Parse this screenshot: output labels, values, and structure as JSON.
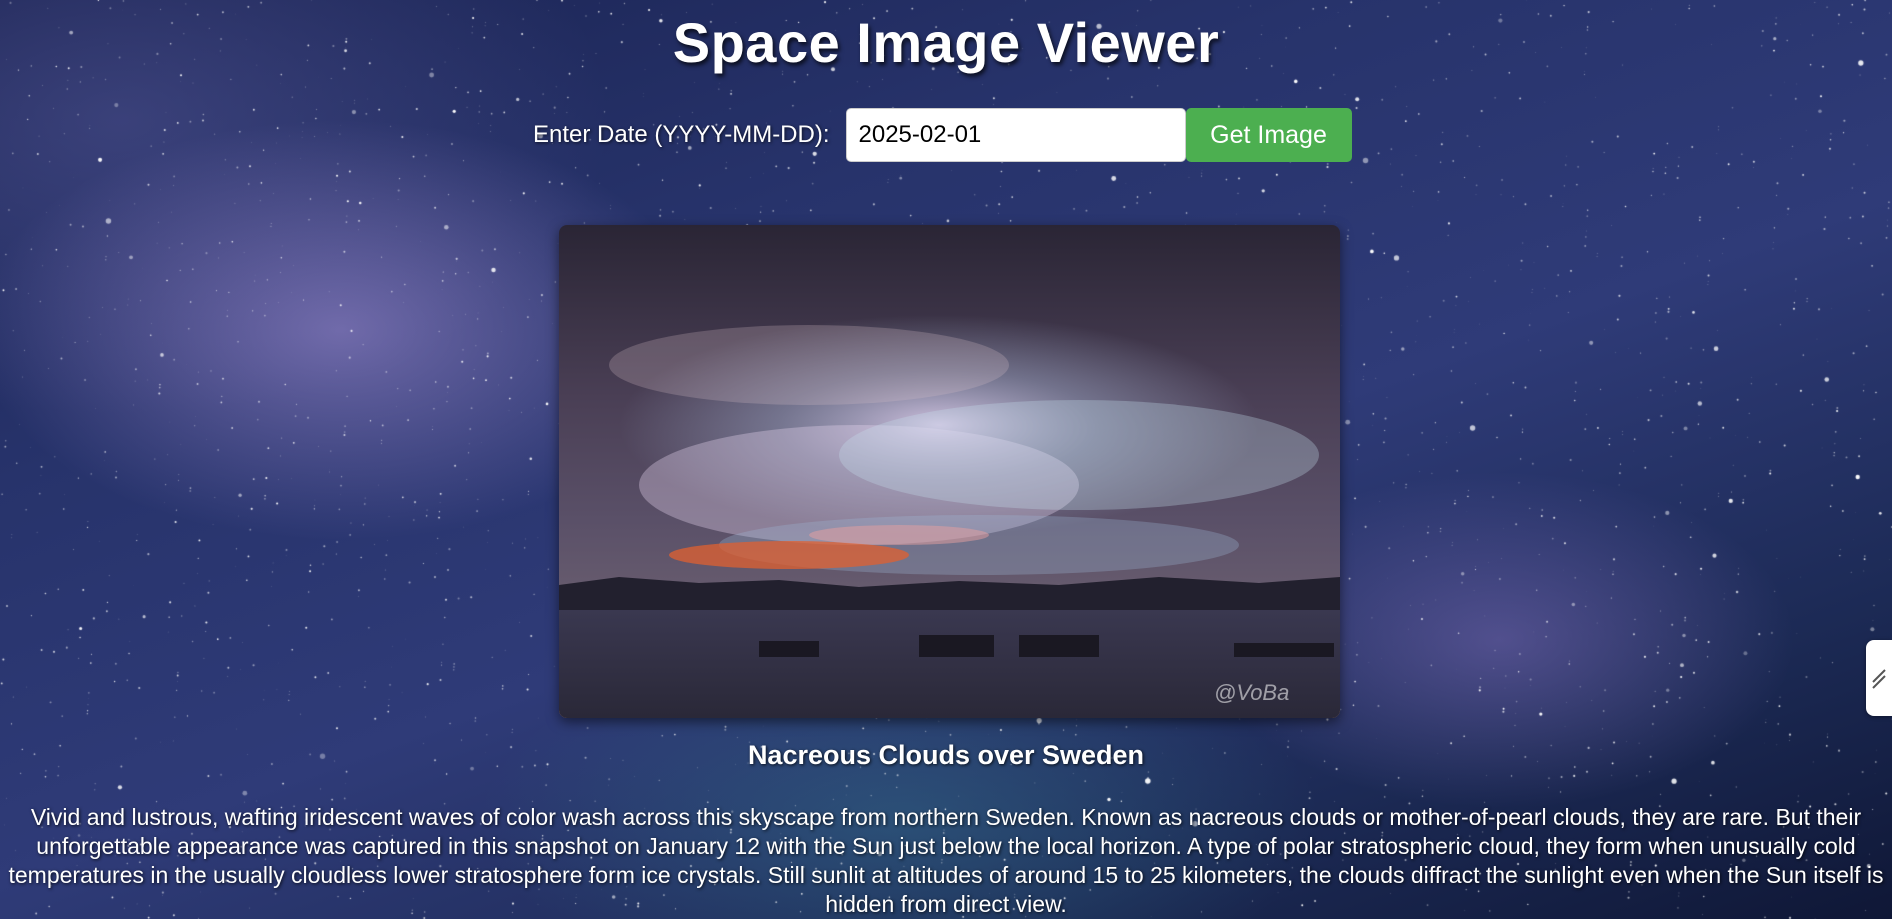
{
  "header": {
    "title": "Space Image Viewer"
  },
  "date_form": {
    "label": "Enter Date (YYYY-MM-DD):",
    "input_value": "2025-02-01",
    "button_label": "Get Image"
  },
  "apod": {
    "image_watermark": "@VoBa",
    "title": "Nacreous Clouds over Sweden",
    "explanation": "Vivid and lustrous, wafting iridescent waves of color wash across this skyscape from northern Sweden. Known as nacreous clouds or mother-of-pearl clouds, they are rare. But their unforgettable appearance was captured in this snapshot on January 12 with the Sun just below the local horizon. A type of polar stratospheric cloud, they form when unusually cold temperatures in the usually cloudless lower stratosphere form ice crystals. Still sunlit at altitudes of around 15 to 25 kilometers, the clouds diffract the sunlight even when the Sun itself is hidden from direct view."
  },
  "side_tab": {
    "icon": "sidebar-handle-icon"
  },
  "colors": {
    "button_bg": "#4caf50",
    "text": "#ffffff",
    "background": "#27336b"
  }
}
